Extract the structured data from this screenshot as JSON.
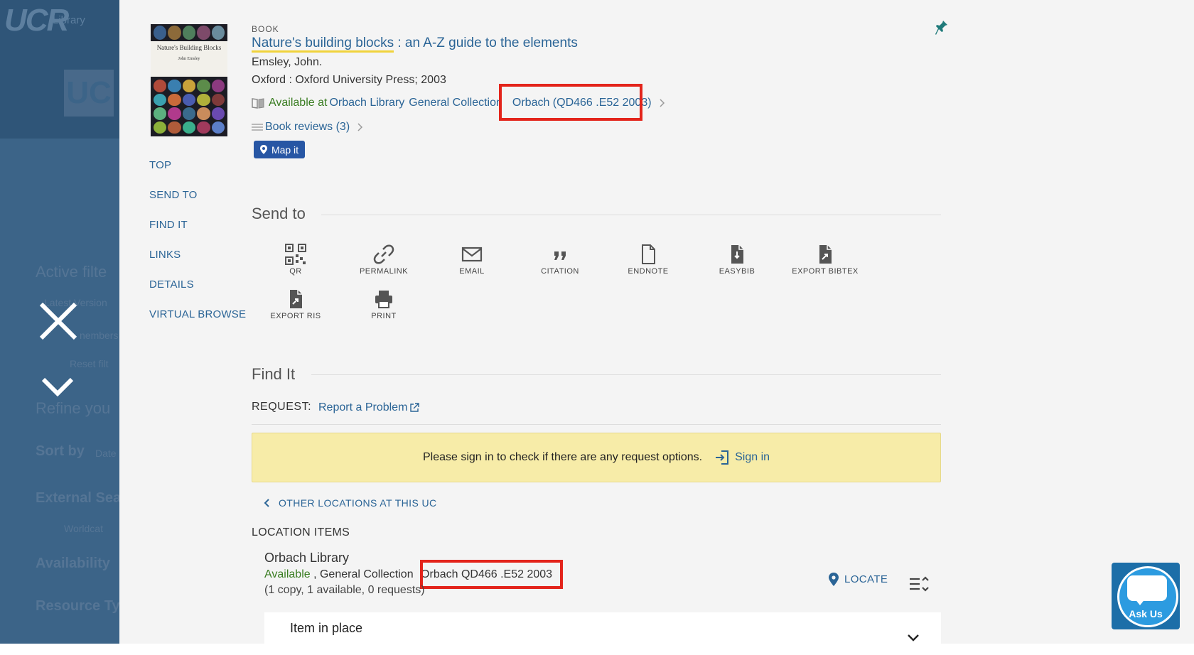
{
  "backdrop": {
    "logo": "UCR",
    "library": "Library",
    "uc": "UC",
    "active_filters": "Active filte",
    "latest_version": "Latest Version",
    "members": "nembers",
    "reset": "Reset filt",
    "refine": "Refine you",
    "sort_by": "Sort by",
    "sort_value": "Date",
    "external": "External Sea",
    "worldcat": "Worldcat",
    "availability": "Availability",
    "resource_type": "Resource Ty"
  },
  "nav": {
    "items": [
      "TOP",
      "SEND TO",
      "FIND IT",
      "LINKS",
      "DETAILS",
      "VIRTUAL BROWSE"
    ]
  },
  "record": {
    "type": "BOOK",
    "title_main": "Nature's building blocks",
    "title_sub": " : an A-Z guide to the elements",
    "author": "Emsley, John.",
    "publisher": "Oxford : Oxford University Press; 2003",
    "avail_prefix": "Available at ",
    "avail_location": "Orbach Library",
    "avail_collection": "General Collection",
    "call_number": "Orbach (QD466 .E52 2003)",
    "reviews": "Book reviews (3)",
    "map_it": "Map it",
    "cover_title": "Nature's Building Blocks",
    "cover_author": "John Emsley"
  },
  "send_to": {
    "heading": "Send to",
    "items": [
      {
        "label": "QR",
        "icon": "qr-icon"
      },
      {
        "label": "PERMALINK",
        "icon": "link-icon"
      },
      {
        "label": "EMAIL",
        "icon": "email-icon"
      },
      {
        "label": "CITATION",
        "icon": "quote-icon"
      },
      {
        "label": "ENDNOTE",
        "icon": "document-icon"
      },
      {
        "label": "EASYBIB",
        "icon": "easybib-icon"
      },
      {
        "label": "EXPORT BIBTEX",
        "icon": "export-icon"
      },
      {
        "label": "EXPORT RIS",
        "icon": "export-icon"
      },
      {
        "label": "PRINT",
        "icon": "printer-icon"
      }
    ]
  },
  "find_it": {
    "heading": "Find It",
    "request_label": "REQUEST:",
    "report_problem": "Report a Problem",
    "notice": "Please sign in to check if there are any request options.",
    "sign_in": "Sign in",
    "other_locations": "OTHER LOCATIONS AT THIS UC",
    "location_items": "LOCATION ITEMS",
    "library_name": "Orbach Library",
    "status": "Available",
    "collection": " , General Collection ",
    "call_number": "Orbach QD466 .E52 2003",
    "copies": "(1 copy, 1 available, 0 requests)",
    "locate": "LOCATE",
    "item_status": "Item in place"
  },
  "widgets": {
    "ask_us": "Ask Us"
  },
  "colors": {
    "link": "#2a6496",
    "available": "#3a7d22",
    "highlight_box": "#e3241b",
    "notice_bg": "#f7eca8",
    "map_button": "#2756a4"
  }
}
